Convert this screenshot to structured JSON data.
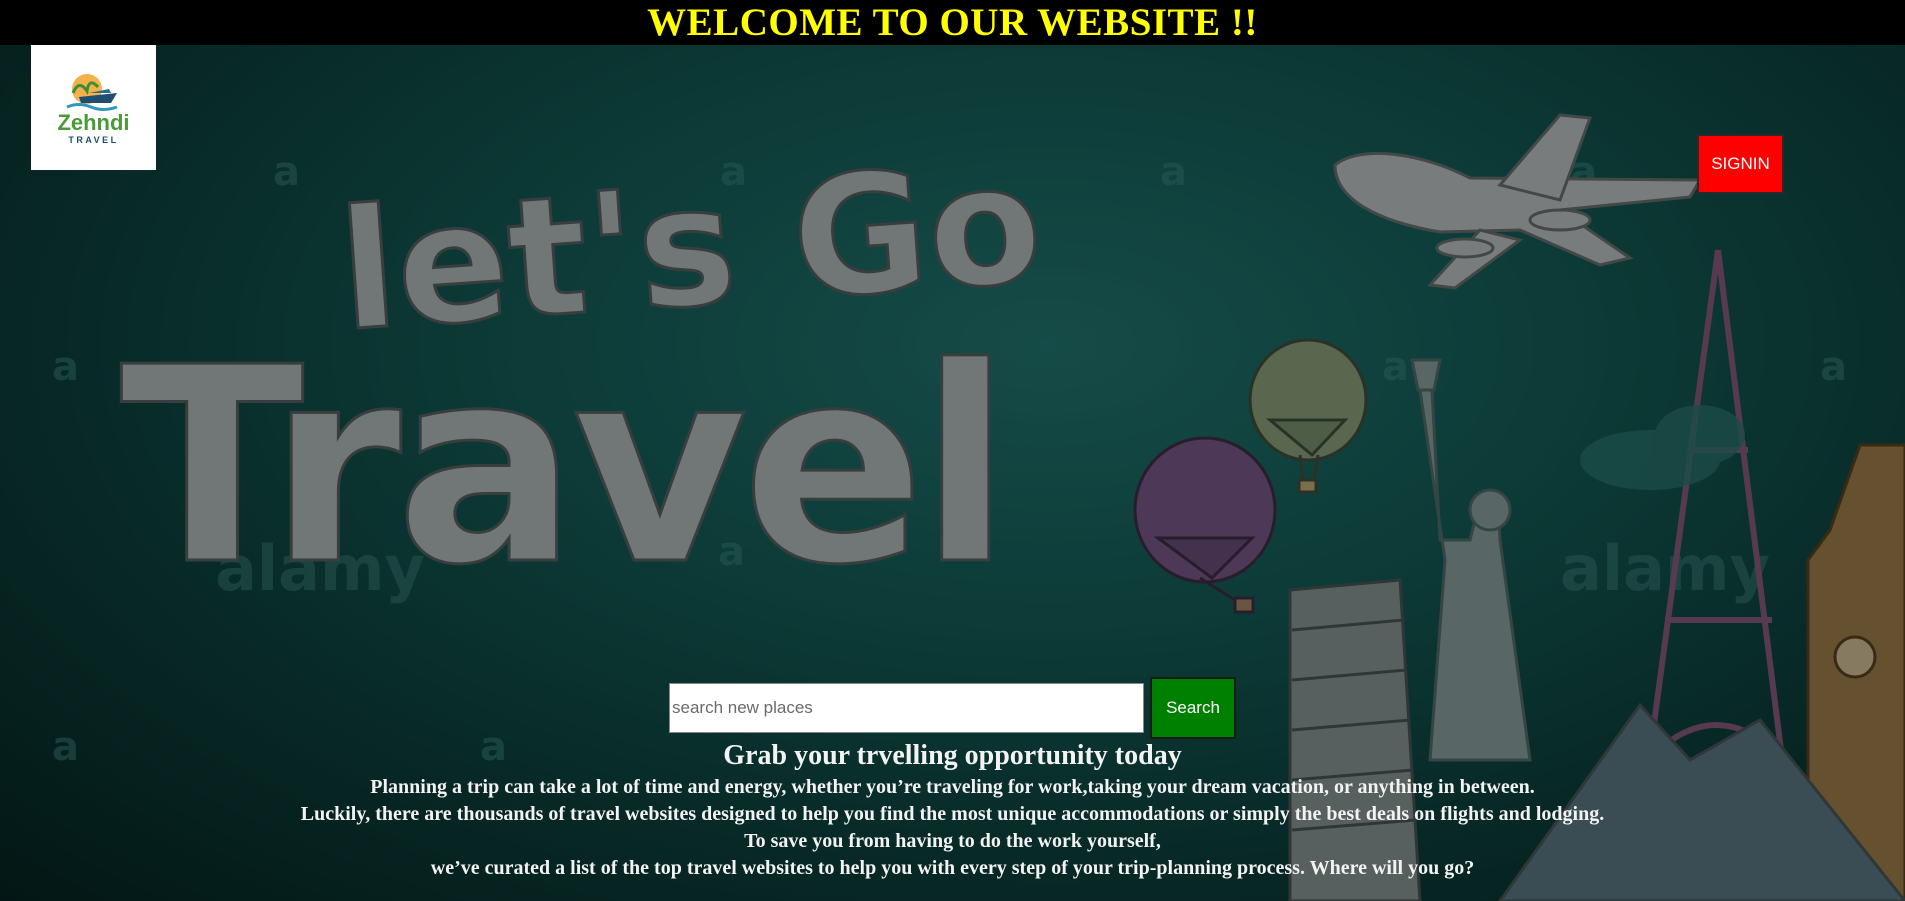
{
  "banner": {
    "title": "WELCOME TO OUR WEBSITE !!",
    "text_color": "#ffff00",
    "background": "#000000"
  },
  "logo": {
    "name": "Zehndi",
    "subtitle": "TRAVEL"
  },
  "hero": {
    "headline_line1": "let's Go",
    "headline_line2": "Travel"
  },
  "signin_button": {
    "label": "SIGNIN",
    "color": "#ff0000"
  },
  "search": {
    "placeholder": "search new places",
    "value": "",
    "button_label": "Search",
    "button_color": "#008000"
  },
  "intro": {
    "heading": "Grab your trvelling opportunity today",
    "lines": [
      "Planning a trip can take a lot of time and energy, whether you’re traveling for work,taking your dream vacation, or anything in between.",
      "Luckily, there are thousands of travel websites designed to help you find the most unique accommodations or simply the best deals on flights and lodging.",
      "To save you from having to do the work yourself,",
      "we’ve curated a list of the top travel websites to help you with every step of your trip-planning process. Where will you go?"
    ]
  }
}
